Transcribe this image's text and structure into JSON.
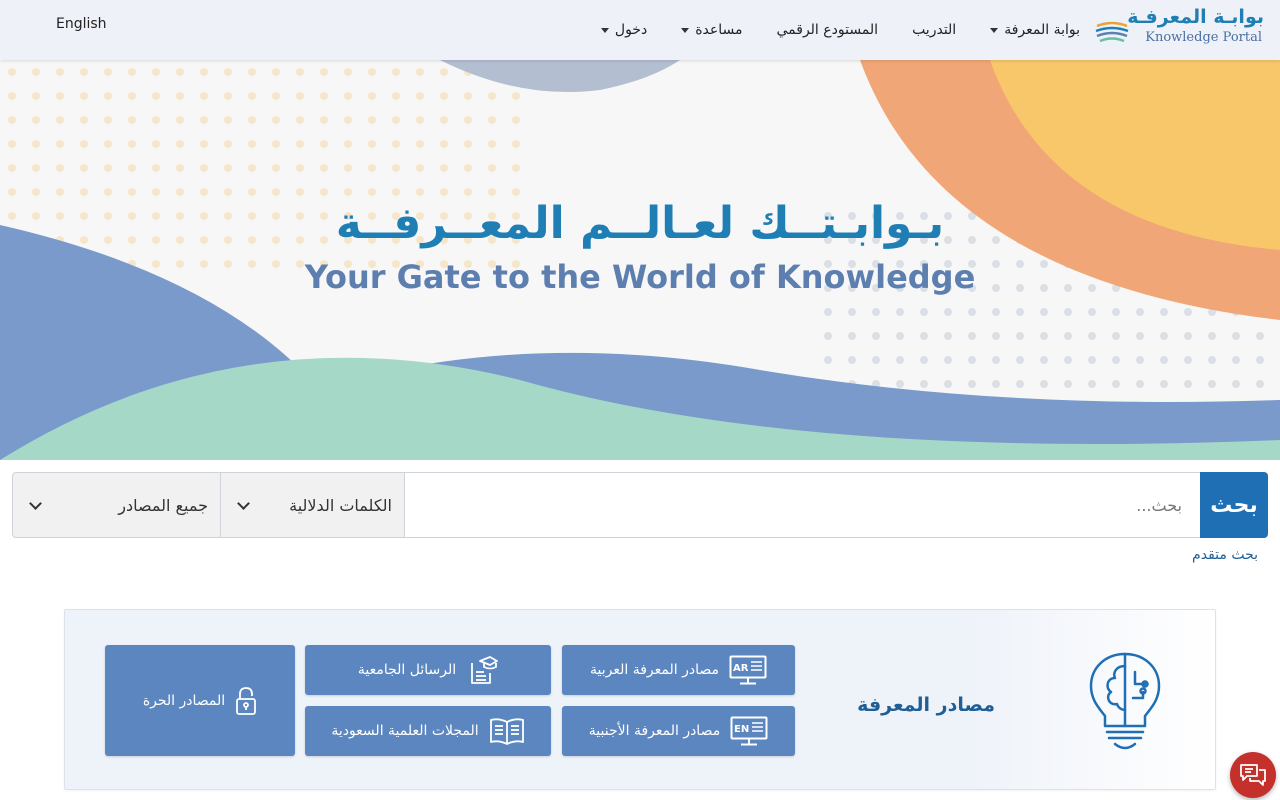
{
  "header": {
    "language_link": "English",
    "logo": {
      "ar": "بوابـة المعرفـة",
      "en": "Knowledge Portal"
    },
    "nav": [
      {
        "label": "بوابة المعرفة",
        "has_dropdown": true
      },
      {
        "label": "التدريب",
        "has_dropdown": false
      },
      {
        "label": "المستودع الرقمي",
        "has_dropdown": false
      },
      {
        "label": "مساعدة",
        "has_dropdown": true
      },
      {
        "label": "دخول",
        "has_dropdown": true
      }
    ]
  },
  "hero": {
    "title_ar": "بـوابـتــك لعـالــم المعــرفــة",
    "title_en": "Your Gate to the World of Knowledge"
  },
  "search": {
    "button_label": "بحث",
    "placeholder": "بحث...",
    "field_select": "الكلمات الدلالية",
    "source_select": "جميع المصادر",
    "advanced_link": "بحث متقدم"
  },
  "resources": {
    "title": "مصادر المعرفة",
    "buttons": {
      "arabic": "مصادر المعرفة العربية",
      "foreign": "مصادر المعرفة الأجنبية",
      "theses": "الرسائل الجامعية",
      "journals": "المجلات العلمية السعودية",
      "open": "المصادر الحرة"
    },
    "icon_badges": {
      "arabic": "AR",
      "foreign": "EN"
    }
  },
  "colors": {
    "primary": "#1f6fb5",
    "title_blue": "#1f7fb5",
    "resource_button": "#5b86bf",
    "chat_button": "#c4302b",
    "hero_blue": "#7a9acb",
    "hero_green": "#a6d8c8",
    "hero_orange": "#f0a676",
    "hero_yellow": "#f8c76a"
  },
  "icons": [
    "knowledge-portal-logo-icon",
    "caret-down-icon",
    "chevron-down-icon",
    "monitor-ar-icon",
    "monitor-en-icon",
    "graduation-cap-doc-icon",
    "open-book-icon",
    "padlock-icon",
    "brain-bulb-icon",
    "chat-icon"
  ]
}
